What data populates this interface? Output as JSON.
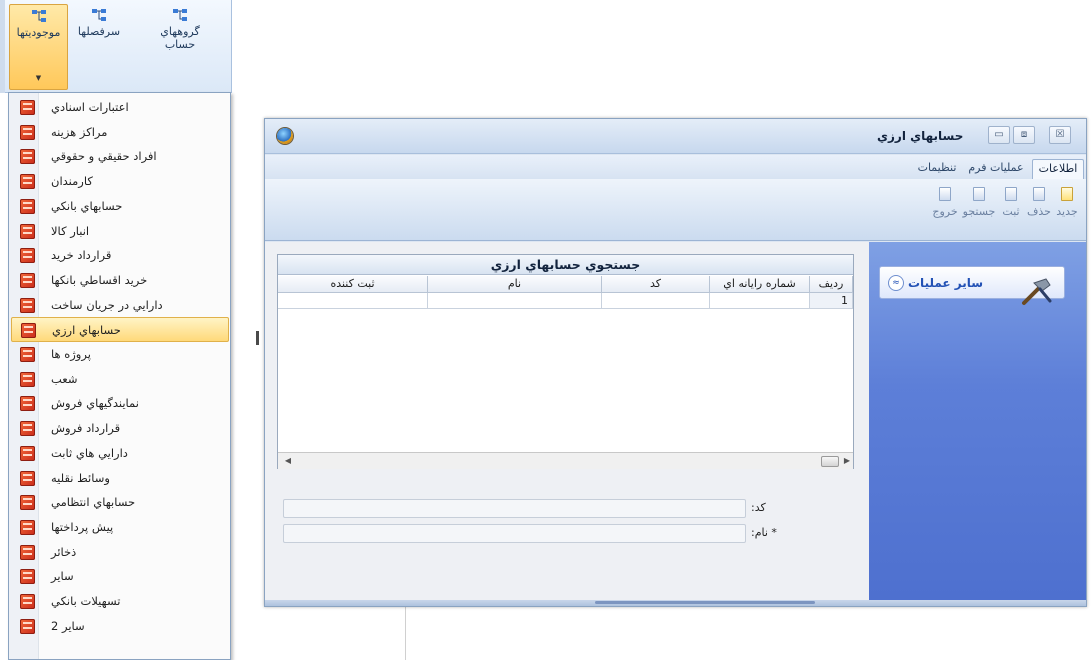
{
  "ribbon": {
    "buttons": [
      {
        "label": "موجوديتها",
        "icon": "entities-icon"
      },
      {
        "label": "سرفصلها",
        "icon": "headings-icon"
      },
      {
        "label": "گروههاي حساب",
        "icon": "account-groups-icon"
      }
    ]
  },
  "menu": {
    "items": [
      "اعتبارات اسنادي",
      "مراكز هزينه",
      "افراد حقيقي و حقوقي",
      "كارمندان",
      "حسابهاي بانكي",
      "انبار كالا",
      "قرارداد خريد",
      "خريد اقساطي بانكها",
      "دارايي در جريان ساخت",
      "حسابهاي ارزي",
      "پروژه ها",
      "شعب",
      "نمايندگيهاي فروش",
      "قرارداد فروش",
      "دارايي هاي ثابت",
      "وسائط نقليه",
      "حسابهاي انتظامي",
      "پيش پرداختها",
      "ذخائر",
      "ساير",
      "تسهيلات بانكي",
      "ساير 2"
    ],
    "selected_index": 9
  },
  "window": {
    "title": "حسابهاي ارزي",
    "controls": {
      "close": "☒",
      "restore": "⧈",
      "minimize": "▭"
    },
    "tabs": [
      "اطلاعات",
      "عمليات فرم",
      "تنظيمات"
    ],
    "active_tab": 0,
    "toolbar": [
      "جديد",
      "حذف",
      "ثبت",
      "جستجو",
      "خروج"
    ],
    "grid": {
      "title": "جستجوي حسابهاي ارزي",
      "columns": [
        "رديف",
        "شماره رايانه اي",
        "كد",
        "نام",
        "ثبت كننده"
      ],
      "rows": [
        [
          "1",
          "",
          "",
          "",
          ""
        ]
      ]
    },
    "form": {
      "code_label": "كد:",
      "name_label": "* نام:",
      "code_value": "",
      "name_value": ""
    },
    "side_panel": {
      "title": "ساير عمليات",
      "chevron": "≈"
    }
  },
  "colors": {
    "ribbon_active": "#ffc85a",
    "side_panel": "#5d7fd8",
    "menu_icon": "#d9381e"
  }
}
